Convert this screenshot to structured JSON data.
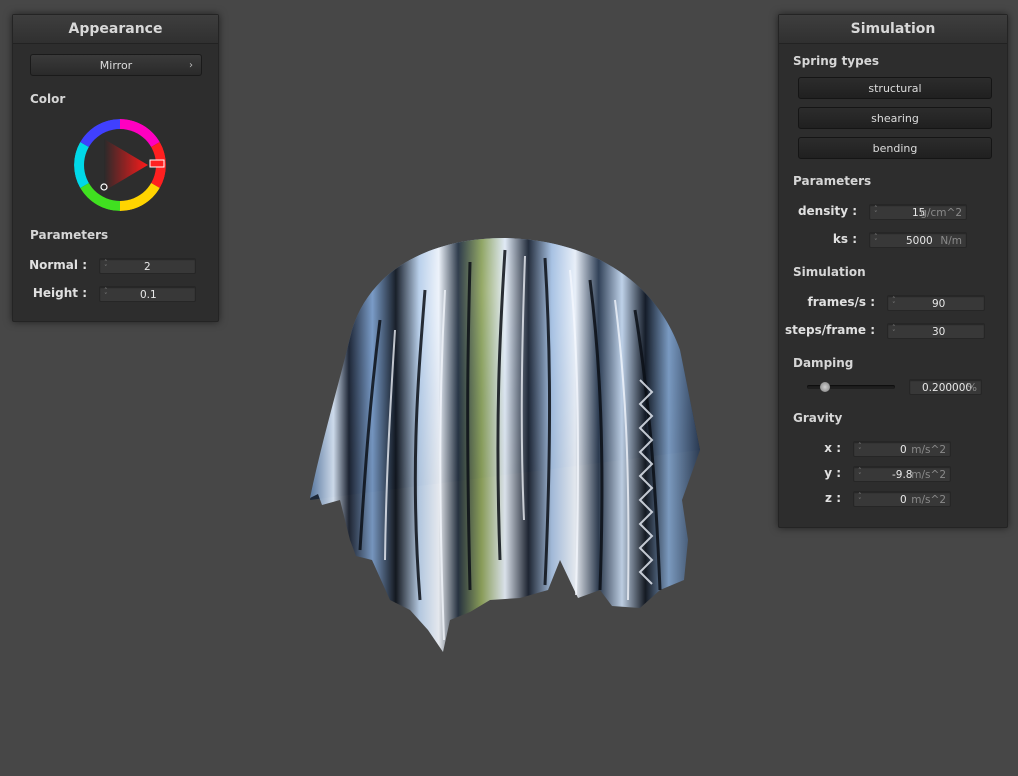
{
  "appearance": {
    "title": "Appearance",
    "shader_dropdown": "Mirror",
    "color_label": "Color",
    "parameters_label": "Parameters",
    "normal_label": "Normal :",
    "normal_value": "2",
    "height_label": "Height :",
    "height_value": "0.1",
    "selected_color": "#ff0000"
  },
  "simulation": {
    "title": "Simulation",
    "spring_types_label": "Spring types",
    "spring_types": [
      "structural",
      "shearing",
      "bending"
    ],
    "parameters_label": "Parameters",
    "density_label": "density :",
    "density_value": "15",
    "density_unit": "g/cm^2",
    "ks_label": "ks :",
    "ks_value": "5000",
    "ks_unit": "N/m",
    "simulation_label": "Simulation",
    "fps_label": "frames/s :",
    "fps_value": "90",
    "steps_label": "steps/frame :",
    "steps_value": "30",
    "damping_label": "Damping",
    "damping_value": "0.200000",
    "damping_unit": "%",
    "damping_level": 0.2,
    "gravity_label": "Gravity",
    "gx_label": "x :",
    "gx_value": "0",
    "gy_label": "y :",
    "gy_value": "-9.8",
    "gz_label": "z :",
    "gz_value": "0",
    "gravity_unit": "m/s^2"
  },
  "colors": {
    "background": "#474747",
    "panel": "#2d2d2d",
    "cloth_highlight": "#bcd4f0",
    "cloth_shadow": "#141a24"
  }
}
